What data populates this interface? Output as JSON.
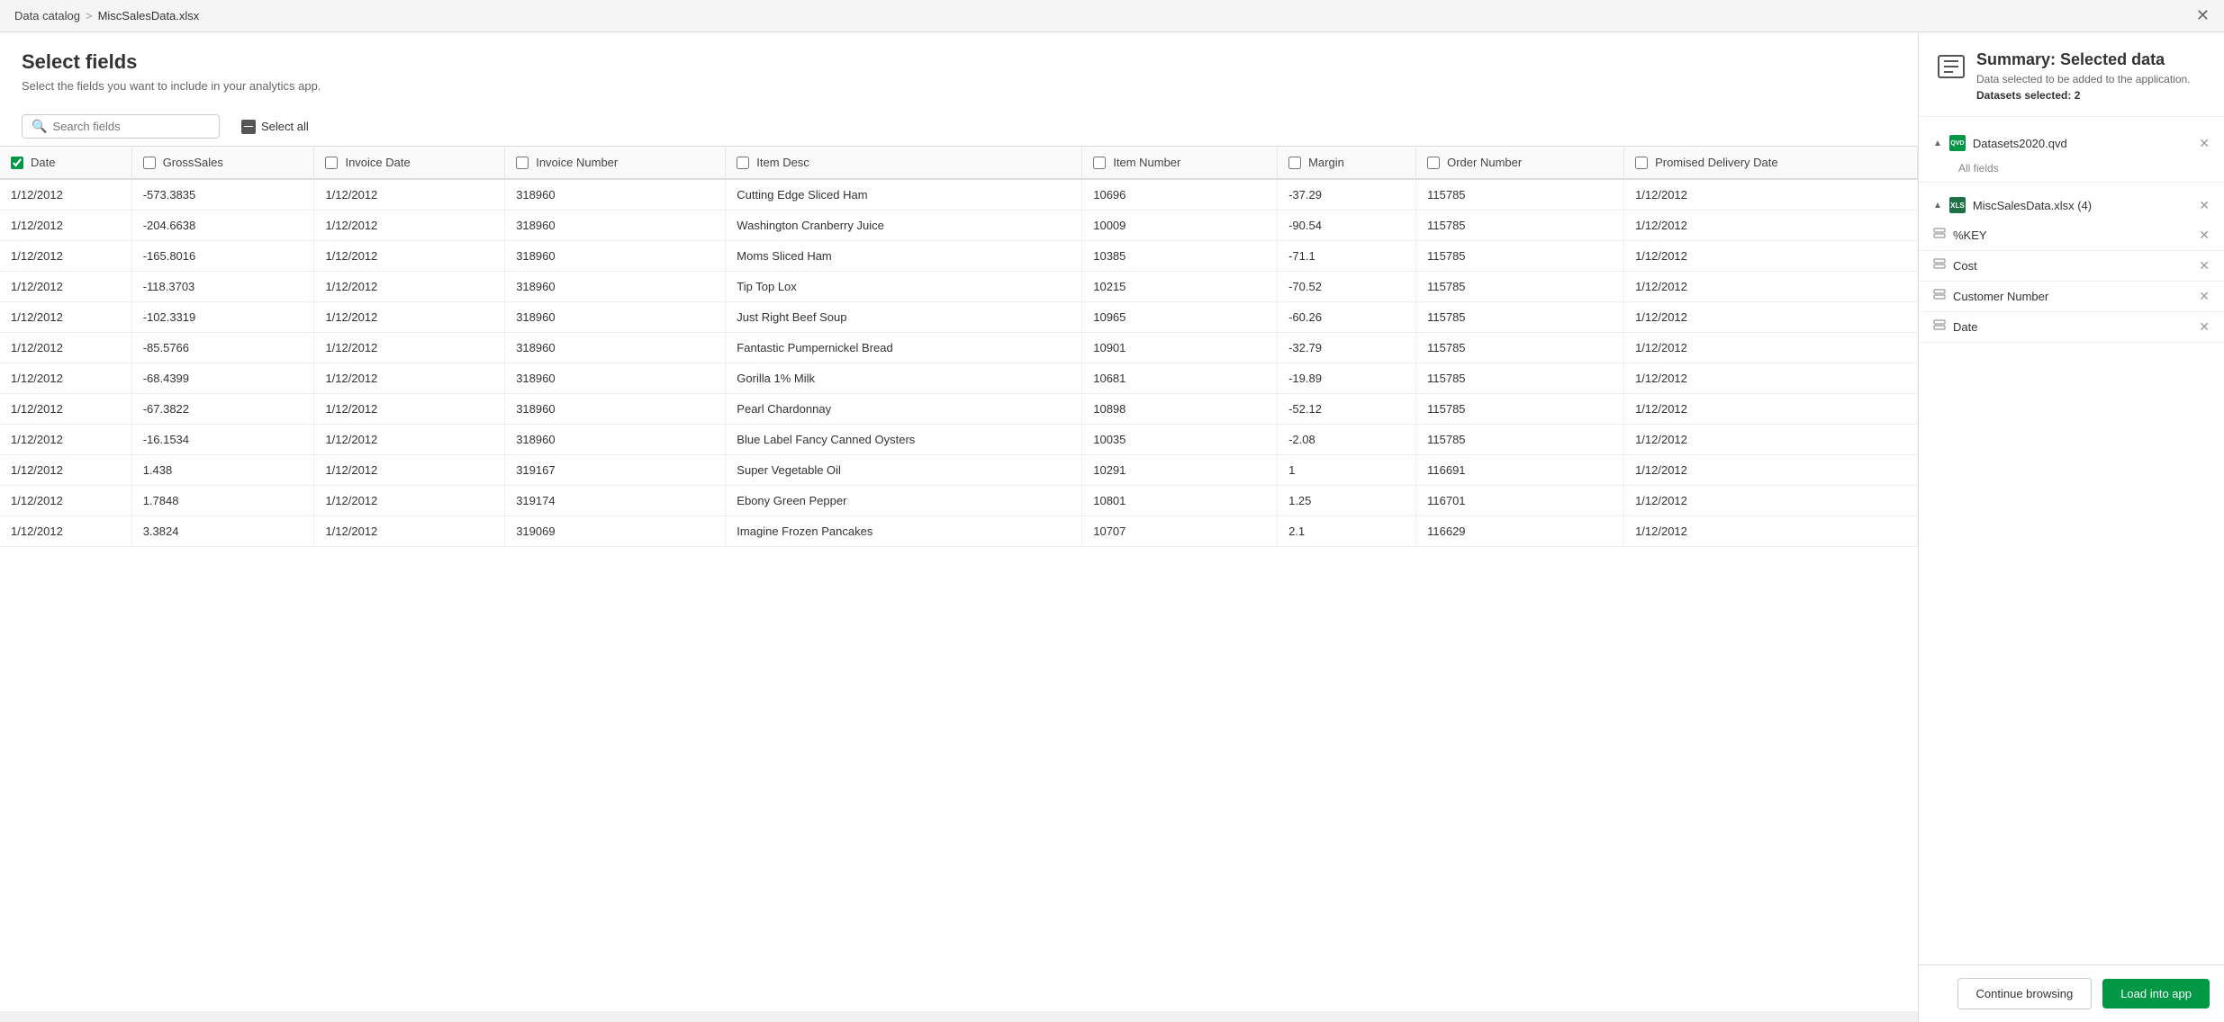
{
  "topBar": {
    "breadcrumb1": "Data catalog",
    "breadcrumbSep": ">",
    "breadcrumb2": "MiscSalesData.xlsx"
  },
  "header": {
    "title": "Select fields",
    "subtitle": "Select the fields you want to include in your analytics app."
  },
  "toolbar": {
    "searchPlaceholder": "Search fields",
    "selectAllLabel": "Select all"
  },
  "tableColumns": [
    {
      "id": "date",
      "label": "Date",
      "checked": true
    },
    {
      "id": "grossSales",
      "label": "GrossSales",
      "checked": false
    },
    {
      "id": "invoiceDate",
      "label": "Invoice Date",
      "checked": false
    },
    {
      "id": "invoiceNumber",
      "label": "Invoice Number",
      "checked": false
    },
    {
      "id": "itemDesc",
      "label": "Item Desc",
      "checked": false
    },
    {
      "id": "itemNumber",
      "label": "Item Number",
      "checked": false
    },
    {
      "id": "margin",
      "label": "Margin",
      "checked": false
    },
    {
      "id": "orderNumber",
      "label": "Order Number",
      "checked": false
    },
    {
      "id": "promisedDeliveryDate",
      "label": "Promised Delivery Date",
      "checked": false
    }
  ],
  "tableRows": [
    {
      "date": "1/12/2012",
      "grossSales": "-573.3835",
      "invoiceDate": "1/12/2012",
      "invoiceNumber": "318960",
      "itemDesc": "Cutting Edge Sliced Ham",
      "itemNumber": "10696",
      "margin": "-37.29",
      "orderNumber": "115785",
      "promisedDeliveryDate": "1/12/2012"
    },
    {
      "date": "1/12/2012",
      "grossSales": "-204.6638",
      "invoiceDate": "1/12/2012",
      "invoiceNumber": "318960",
      "itemDesc": "Washington Cranberry Juice",
      "itemNumber": "10009",
      "margin": "-90.54",
      "orderNumber": "115785",
      "promisedDeliveryDate": "1/12/2012"
    },
    {
      "date": "1/12/2012",
      "grossSales": "-165.8016",
      "invoiceDate": "1/12/2012",
      "invoiceNumber": "318960",
      "itemDesc": "Moms Sliced Ham",
      "itemNumber": "10385",
      "margin": "-71.1",
      "orderNumber": "115785",
      "promisedDeliveryDate": "1/12/2012"
    },
    {
      "date": "1/12/2012",
      "grossSales": "-118.3703",
      "invoiceDate": "1/12/2012",
      "invoiceNumber": "318960",
      "itemDesc": "Tip Top Lox",
      "itemNumber": "10215",
      "margin": "-70.52",
      "orderNumber": "115785",
      "promisedDeliveryDate": "1/12/2012"
    },
    {
      "date": "1/12/2012",
      "grossSales": "-102.3319",
      "invoiceDate": "1/12/2012",
      "invoiceNumber": "318960",
      "itemDesc": "Just Right Beef Soup",
      "itemNumber": "10965",
      "margin": "-60.26",
      "orderNumber": "115785",
      "promisedDeliveryDate": "1/12/2012"
    },
    {
      "date": "1/12/2012",
      "grossSales": "-85.5766",
      "invoiceDate": "1/12/2012",
      "invoiceNumber": "318960",
      "itemDesc": "Fantastic Pumpernickel Bread",
      "itemNumber": "10901",
      "margin": "-32.79",
      "orderNumber": "115785",
      "promisedDeliveryDate": "1/12/2012"
    },
    {
      "date": "1/12/2012",
      "grossSales": "-68.4399",
      "invoiceDate": "1/12/2012",
      "invoiceNumber": "318960",
      "itemDesc": "Gorilla 1% Milk",
      "itemNumber": "10681",
      "margin": "-19.89",
      "orderNumber": "115785",
      "promisedDeliveryDate": "1/12/2012"
    },
    {
      "date": "1/12/2012",
      "grossSales": "-67.3822",
      "invoiceDate": "1/12/2012",
      "invoiceNumber": "318960",
      "itemDesc": "Pearl Chardonnay",
      "itemNumber": "10898",
      "margin": "-52.12",
      "orderNumber": "115785",
      "promisedDeliveryDate": "1/12/2012"
    },
    {
      "date": "1/12/2012",
      "grossSales": "-16.1534",
      "invoiceDate": "1/12/2012",
      "invoiceNumber": "318960",
      "itemDesc": "Blue Label Fancy Canned Oysters",
      "itemNumber": "10035",
      "margin": "-2.08",
      "orderNumber": "115785",
      "promisedDeliveryDate": "1/12/2012"
    },
    {
      "date": "1/12/2012",
      "grossSales": "1.438",
      "invoiceDate": "1/12/2012",
      "invoiceNumber": "319167",
      "itemDesc": "Super Vegetable Oil",
      "itemNumber": "10291",
      "margin": "1",
      "orderNumber": "116691",
      "promisedDeliveryDate": "1/12/2012"
    },
    {
      "date": "1/12/2012",
      "grossSales": "1.7848",
      "invoiceDate": "1/12/2012",
      "invoiceNumber": "319174",
      "itemDesc": "Ebony Green Pepper",
      "itemNumber": "10801",
      "margin": "1.25",
      "orderNumber": "116701",
      "promisedDeliveryDate": "1/12/2012"
    },
    {
      "date": "1/12/2012",
      "grossSales": "3.3824",
      "invoiceDate": "1/12/2012",
      "invoiceNumber": "319069",
      "itemDesc": "Imagine Frozen Pancakes",
      "itemNumber": "10707",
      "margin": "2.1",
      "orderNumber": "116629",
      "promisedDeliveryDate": "1/12/2012"
    }
  ],
  "summary": {
    "title": "Summary: Selected data",
    "subtitle": "Data selected to be added to the application.",
    "datasetsCount": "Datasets selected: 2",
    "dataset1": {
      "name": "Datasets2020.qvd",
      "allFieldsLabel": "All fields",
      "collapseState": "▲"
    },
    "dataset2": {
      "name": "MiscSalesData.xlsx (4)",
      "collapseState": "▲",
      "fields": [
        {
          "name": "%KEY"
        },
        {
          "name": "Cost"
        },
        {
          "name": "Customer Number"
        },
        {
          "name": "Date"
        }
      ]
    }
  },
  "actions": {
    "continueBrowsing": "Continue browsing",
    "loadIntoApp": "Load into app"
  }
}
